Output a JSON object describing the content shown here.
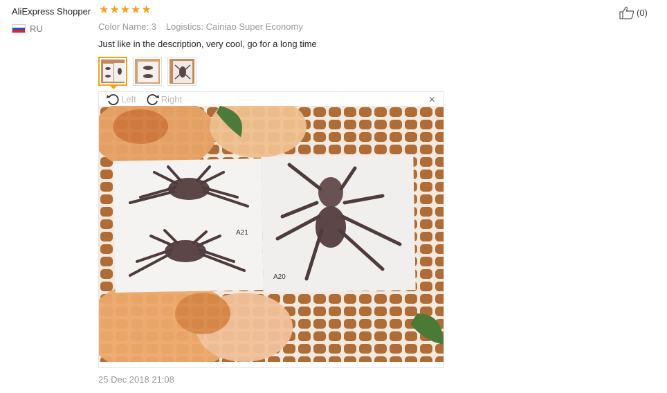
{
  "review": {
    "user_name": "AliExpress Shopper",
    "country_code": "RU",
    "rating": 5,
    "color_name_label": "Color Name:",
    "color_name_value": "3",
    "logistics_label": "Logistics:",
    "logistics_value": "Cainiao Super Economy",
    "text": "Just like in the description, very cool, go for a long time",
    "date": "25 Dec 2018 21:08",
    "likes": "(0)"
  },
  "viewer": {
    "rotate_left_label": "Left",
    "rotate_right_label": "Right",
    "close_label": "×",
    "photo_labels": [
      "A21",
      "A20"
    ]
  },
  "thumbnails": [
    {
      "name": "thumbnail-1",
      "active": true
    },
    {
      "name": "thumbnail-2",
      "active": false
    },
    {
      "name": "thumbnail-3",
      "active": false
    }
  ],
  "icons": {
    "star": "star-icon",
    "like": "thumbs-up-icon",
    "rotate_left": "rotate-left-icon",
    "rotate_right": "rotate-right-icon",
    "close": "close-icon",
    "flag": "russia-flag-icon"
  },
  "colors": {
    "star": "#f7a11b",
    "muted_text": "#999999"
  }
}
